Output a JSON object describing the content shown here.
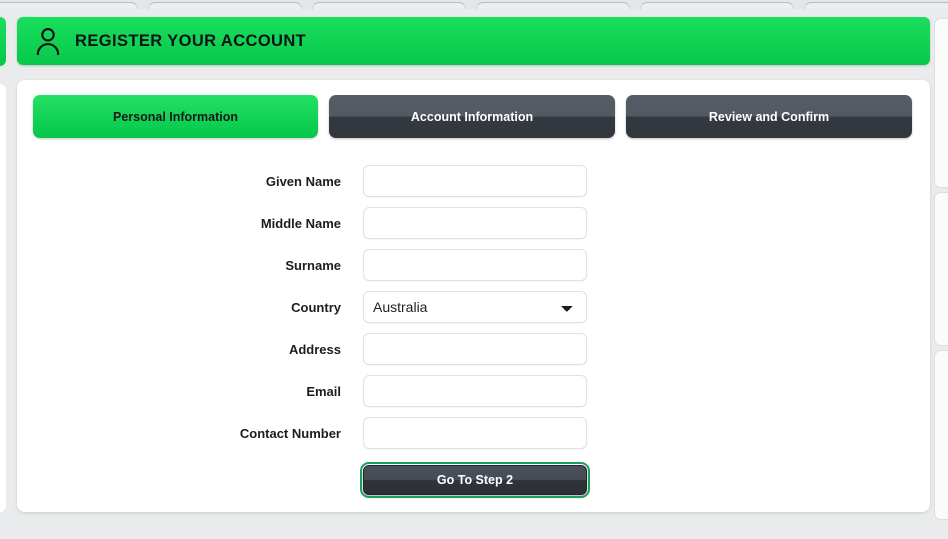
{
  "header": {
    "icon": "user-icon",
    "title": "REGISTER YOUR ACCOUNT",
    "background_color": "#0fce4f"
  },
  "tabs": [
    {
      "label": "Personal Information",
      "state": "active"
    },
    {
      "label": "Account Information",
      "state": "inactive"
    },
    {
      "label": "Review and Confirm",
      "state": "inactive"
    }
  ],
  "form": {
    "fields": [
      {
        "label": "Given Name",
        "type": "text",
        "value": "",
        "placeholder": ""
      },
      {
        "label": "Middle Name",
        "type": "text",
        "value": "",
        "placeholder": ""
      },
      {
        "label": "Surname",
        "type": "text",
        "value": "",
        "placeholder": ""
      },
      {
        "label": "Country",
        "type": "select",
        "value": "Australia",
        "options": [
          "Australia"
        ]
      },
      {
        "label": "Address",
        "type": "text",
        "value": "",
        "placeholder": ""
      },
      {
        "label": "Email",
        "type": "text",
        "value": "",
        "placeholder": ""
      },
      {
        "label": "Contact Number",
        "type": "text",
        "value": "",
        "placeholder": ""
      }
    ],
    "submit_label": "Go To Step 2"
  },
  "colors": {
    "accent_green": "#0fce4f",
    "tab_inactive_top": "#565c66",
    "tab_inactive_bottom": "#32363d",
    "focus_ring": "#1e9e57",
    "page_background": "#e9ebec"
  }
}
